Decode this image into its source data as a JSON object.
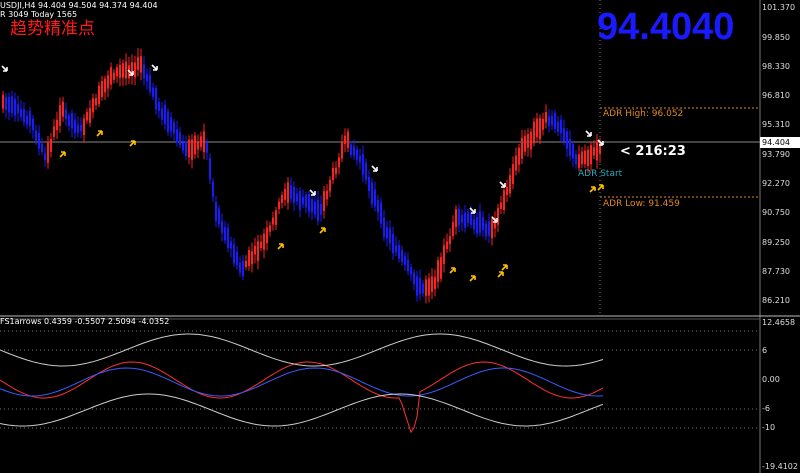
{
  "header": {
    "line1": "USDJI,H4  94.404 94.504 94.374 94.404",
    "line2": "R 3049  Today 1565",
    "chinese_title": "趋势精准点"
  },
  "big_price": "94.4040",
  "adr": {
    "high_label": "ADR High: 96.052",
    "low_label": "ADR Low: 91.459",
    "start_label": "ADR Start"
  },
  "timer": "< 216:23",
  "current_price_tag": "94.404",
  "price_axis": [
    "101.370",
    "99.850",
    "98.330",
    "96.810",
    "95.310",
    "94.404",
    "93.790",
    "92.270",
    "90.750",
    "89.250",
    "87.730",
    "86.210"
  ],
  "indicator": {
    "title": "FS1arrows 0.4359 -0.5507 2.5094 -4.0352",
    "axis": [
      "12.4658",
      "6",
      "0.00",
      "-6",
      "-10",
      "-19.4102"
    ]
  },
  "colors": {
    "bull": "#ff2020",
    "bear": "#1a1aff",
    "arrow_up": "#ffc000",
    "arrow_down": "#ffffff",
    "adr_line": "#e08a1e",
    "big_price": "#1a1aff"
  },
  "icons": {
    "buy_arrow": "yellow-up-arrow-icon",
    "sell_arrow": "white-down-arrow-icon"
  }
}
